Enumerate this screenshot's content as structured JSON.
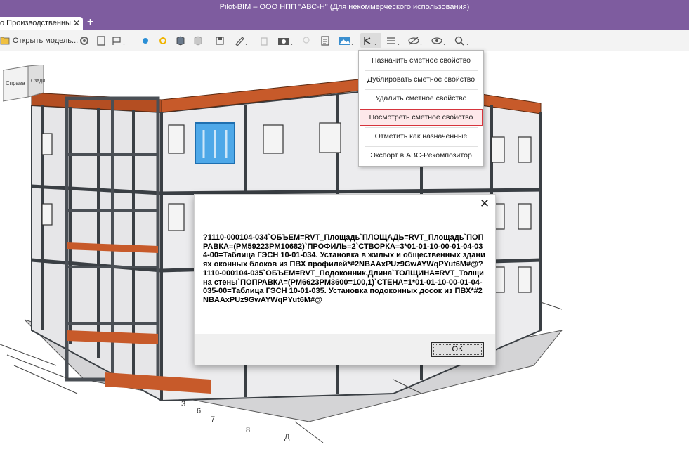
{
  "window": {
    "title": "Pilot-BIM – ООО НПП \"АВС-Н\" (Для некоммерческого использования)"
  },
  "tabs": [
    {
      "label": "о Производственны..."
    }
  ],
  "toolbar": {
    "open_model_label": "Открыть модель...",
    "icons": [
      "folder-icon",
      "gear-icon",
      "frame-icon",
      "flag-icon",
      "blue-dot-icon",
      "yellow-dot-icon",
      "model-icon",
      "model-gray-icon",
      "save-icon",
      "ruler-icon",
      "trash-icon",
      "camera-icon",
      "pin-icon",
      "document-icon",
      "image-icon",
      "estimate-tool-icon",
      "list-icon",
      "hide-icon",
      "eye-icon",
      "search-icon"
    ]
  },
  "dropdown_menu": {
    "items": [
      {
        "label": "Назначить сметное свойство",
        "selected": false
      },
      {
        "label": "Дублировать сметное свойство",
        "selected": false
      },
      {
        "label": "Удалить сметное свойство",
        "selected": false
      },
      {
        "label": "Посмотреть сметное свойство",
        "selected": true
      },
      {
        "label": "Отметить как назначенные",
        "selected": false
      },
      {
        "label": "Экспорт в ABC-Рекомпозитор",
        "selected": false
      }
    ]
  },
  "viewcube": {
    "face_right": "Справа",
    "face_back": "Сзади"
  },
  "dialog": {
    "message": "?1110-000104-034`ОБЪЕМ=RVT_Площадь`ПЛОЩАДЬ=RVT_Площадь`ПОПРАВКА=(PM59223PM10682)`ПРОФИЛЬ=2`СТВОРКА=3*01-01-10-00-01-04-034-00=Таблица ГЭСН 10-01-034. Установка в жилых и общественных зданиях оконных блоков из ПВХ профилей*#2NBAAxPUz9GwAYWqPYut6M#@?1110-000104-035`ОБЪЕМ=RVT_Подоконник.Длина`ТОЛЩИНА=RVT_Толщина стены`ПОПРАВКА=(PM6623PM3600=100,1)`СТЕНА=1*01-01-10-00-01-04-035-00=Таблица ГЭСН 10-01-035. Установка подоконных досок из ПВХ*#2NBAAxPUz9GwAYWqPYut6M#@",
    "ok_label": "OK"
  },
  "colors": {
    "titlebar": "#7e5c9f",
    "selection_border": "#d6343c",
    "roof": "#c75a2a",
    "frame": "#3a3f44",
    "wall": "#e8e8ea",
    "window_glass": "#9bc3e6",
    "selected_window": "#4ea8e8"
  },
  "grid_labels": [
    "3",
    "6",
    "7",
    "8",
    "Д"
  ]
}
